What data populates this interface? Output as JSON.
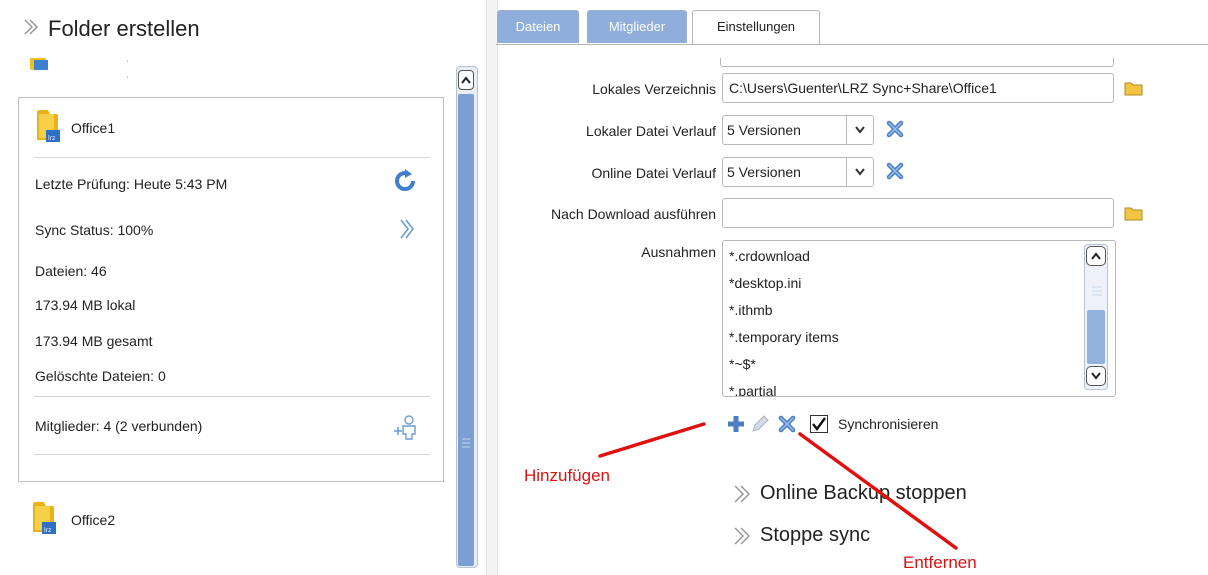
{
  "left": {
    "header": "Folder erstellen",
    "folder_top_partial": "· ·",
    "card": {
      "name": "Office1",
      "last_check": "Letzte Prüfung: Heute 5:43 PM",
      "sync_status": "Sync Status: 100%",
      "files": "Dateien: 46",
      "local_size": "173.94 MB lokal",
      "total_size": "173.94 MB gesamt",
      "deleted": "Gelöschte Dateien: 0",
      "members": "Mitglieder: 4 (2 verbunden)"
    },
    "next_folder": "Office2"
  },
  "tabs": [
    {
      "label": "Dateien",
      "active": false
    },
    {
      "label": "Mitglieder",
      "active": false
    },
    {
      "label": "Einstellungen",
      "active": true
    }
  ],
  "settings": {
    "local_dir_label": "Lokales Verzeichnis",
    "local_dir_value": "C:\\Users\\Guenter\\LRZ Sync+Share\\Office1",
    "local_history_label": "Lokaler Datei Verlauf",
    "local_history_value": "5 Versionen",
    "online_history_label": "Online Datei Verlauf",
    "online_history_value": "5 Versionen",
    "after_download_label": "Nach Download ausführen",
    "after_download_value": "",
    "exceptions_label": "Ausnahmen",
    "exceptions": [
      "*.crdownload",
      "*desktop.ini",
      "*.ithmb",
      "*.temporary items",
      "*~$*",
      "*.partial"
    ],
    "sync_checkbox_label": "Synchronisieren",
    "sync_checked": true
  },
  "actions": {
    "stop_backup": "Online Backup stoppen",
    "stop_sync": "Stoppe sync"
  },
  "annotations": {
    "add": "Hinzufügen",
    "remove": "Entfernen"
  },
  "colors": {
    "tab_inactive": "#8faedb",
    "accent_blue": "#3f7fd0",
    "scroll_thumb": "#7b9fd3",
    "annotation_red": "#e01010",
    "folder_yellow": "#f0c020"
  }
}
